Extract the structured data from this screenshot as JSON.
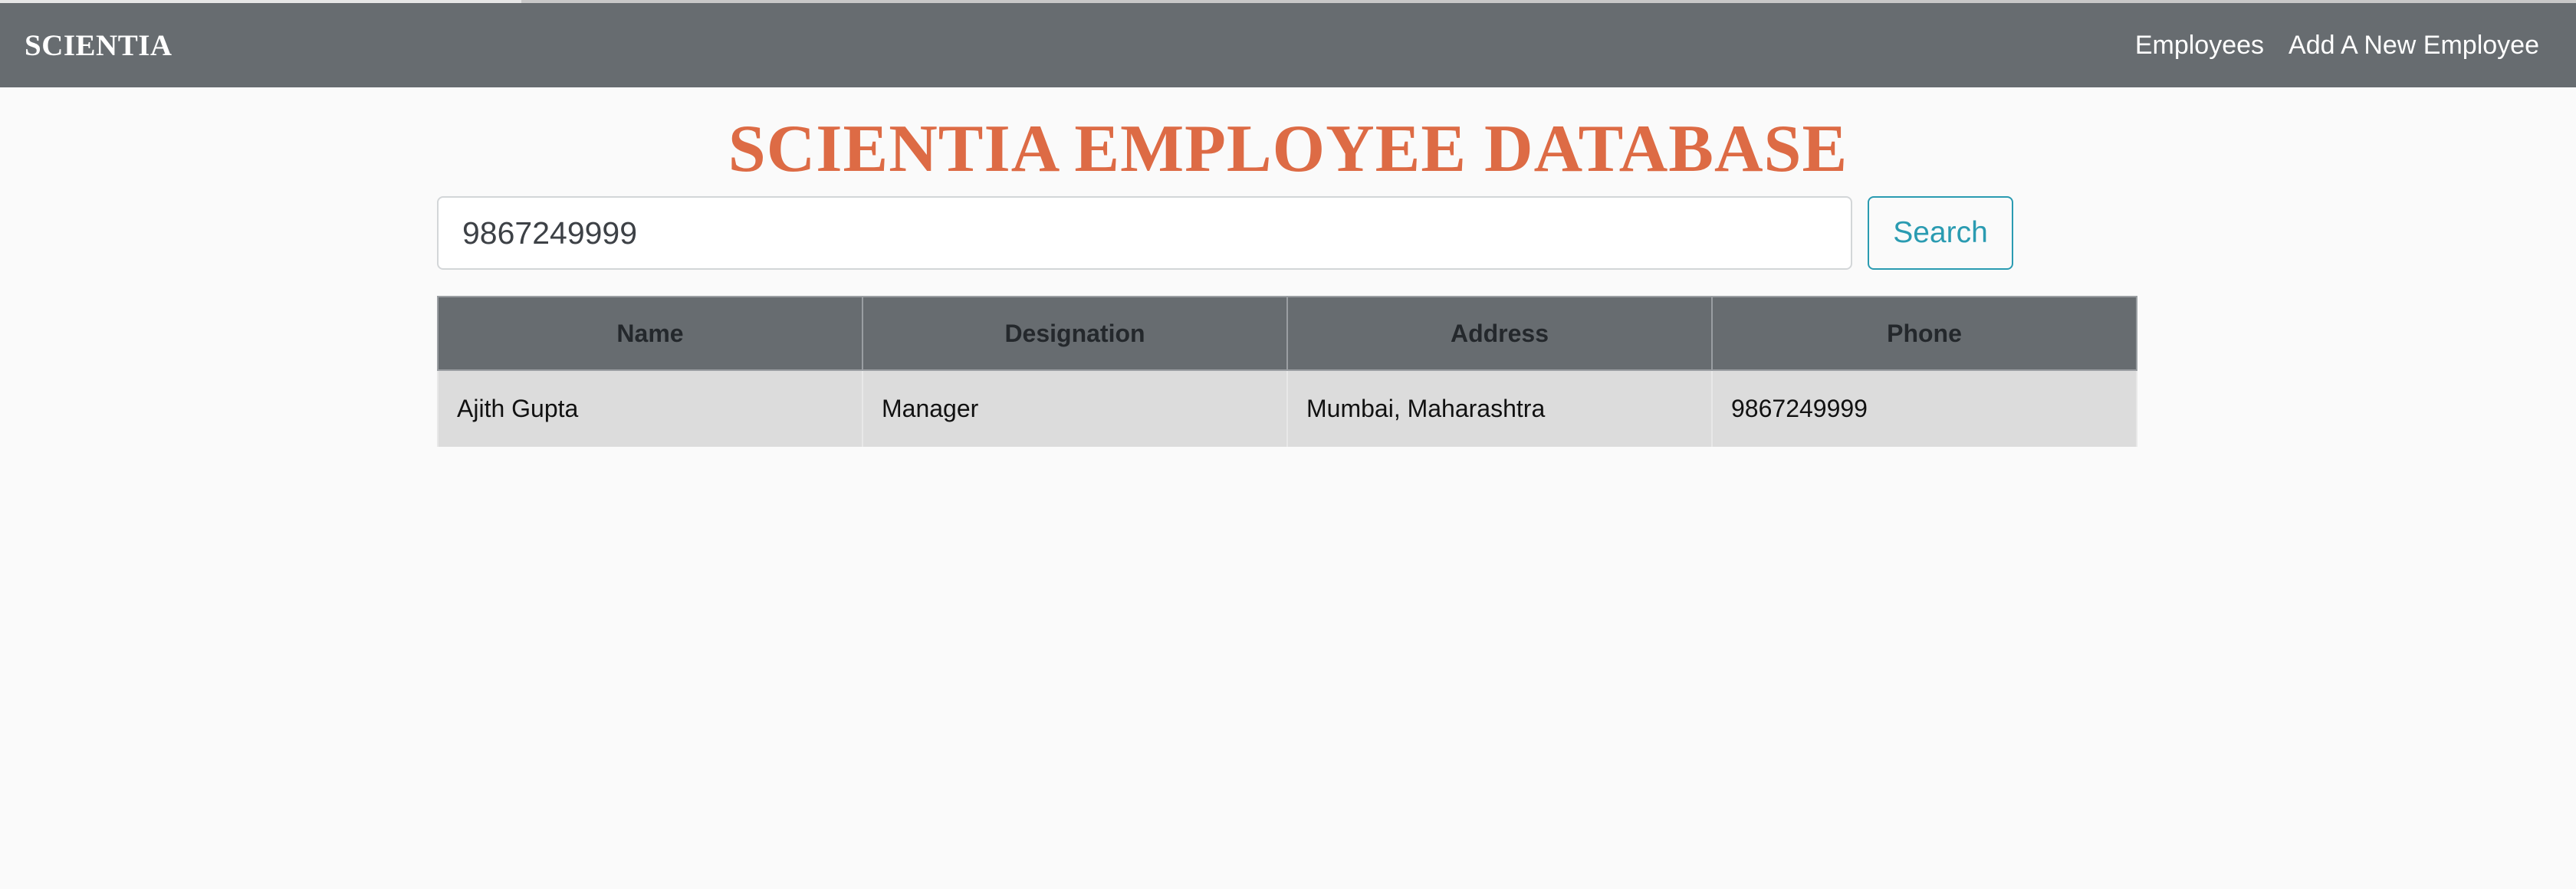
{
  "navbar": {
    "brand": "SCIENTIA",
    "links": [
      "Employees",
      "Add A New Employee"
    ]
  },
  "main": {
    "title": "SCIENTIA EMPLOYEE DATABASE",
    "search": {
      "value": "9867249999",
      "button_label": "Search"
    },
    "table": {
      "headers": [
        "Name",
        "Designation",
        "Address",
        "Phone"
      ],
      "rows": [
        [
          "Ajith Gupta",
          "Manager",
          "Mumbai, Maharashtra",
          "9867249999"
        ]
      ]
    }
  },
  "colors": {
    "navbar_bg": "#676c70",
    "title": "#dd6b45",
    "accent": "#2a9bb1",
    "row_bg": "#dcdcdc",
    "page_bg": "#fafafa"
  }
}
